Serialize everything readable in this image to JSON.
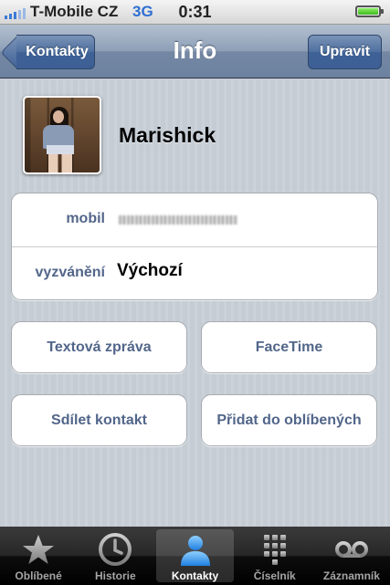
{
  "status_bar": {
    "carrier": "T-Mobile CZ",
    "network": "3G",
    "time": "0:31"
  },
  "nav": {
    "title": "Info",
    "back_label": "Kontakty",
    "edit_label": "Upravit"
  },
  "contact": {
    "name": "Marishick",
    "fields": [
      {
        "label": "mobil",
        "value": ""
      },
      {
        "label": "vyzvánění",
        "value": "Výchozí"
      }
    ]
  },
  "actions": {
    "text_message": "Textová zpráva",
    "facetime": "FaceTime",
    "share_contact": "Sdílet kontakt",
    "add_favorite": "Přidat do oblíbených"
  },
  "tabs": [
    {
      "label": "Oblíbené",
      "icon": "star-icon",
      "active": false
    },
    {
      "label": "Historie",
      "icon": "clock-icon",
      "active": false
    },
    {
      "label": "Kontakty",
      "icon": "person-icon",
      "active": true
    },
    {
      "label": "Číselník",
      "icon": "keypad-icon",
      "active": false
    },
    {
      "label": "Záznamník",
      "icon": "voicemail-icon",
      "active": false
    }
  ],
  "colors": {
    "nav_bar": "#6d82a0",
    "label_blue": "#52668a",
    "background": "#c5ccd4",
    "active_tab_icon": "#3a9cf0"
  }
}
